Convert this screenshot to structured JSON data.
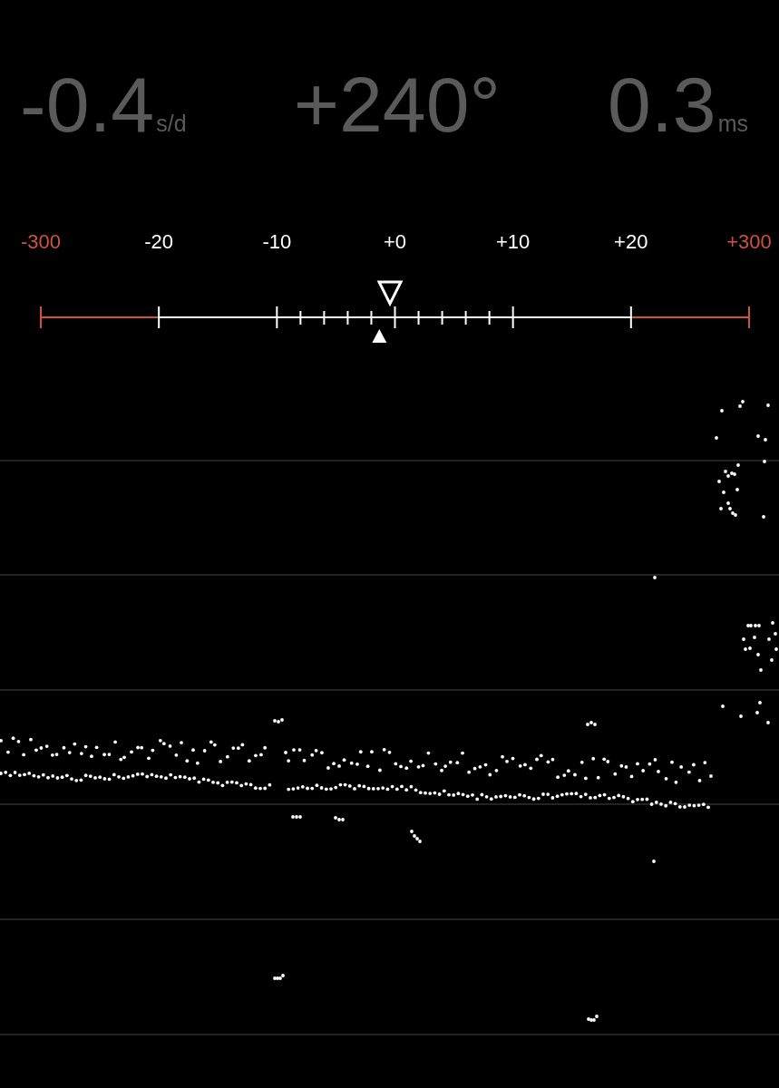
{
  "readings": [
    {
      "value": "-0.4",
      "unit": "s/d"
    },
    {
      "value": "+240°"
    },
    {
      "value": "0.3",
      "unit": "ms"
    }
  ],
  "scale": {
    "ticks": [
      {
        "label": "-300",
        "color": "#cf5240"
      },
      {
        "label": "-20",
        "color": "#ffffff"
      },
      {
        "label": "-10",
        "color": "#ffffff"
      },
      {
        "label": "+0",
        "color": "#ffffff"
      },
      {
        "label": "+10",
        "color": "#ffffff"
      },
      {
        "label": "+20",
        "color": "#ffffff"
      },
      {
        "label": "+300",
        "color": "#cf5240"
      }
    ],
    "segments": [
      {
        "color": "#cf5240",
        "subdivided": false
      },
      {
        "color": "#ffffff",
        "subdivided": false
      },
      {
        "color": "#ffffff",
        "subdivided": true
      },
      {
        "color": "#ffffff",
        "subdivided": true
      },
      {
        "color": "#ffffff",
        "subdivided": false
      },
      {
        "color": "#cf5240",
        "subdivided": false
      }
    ],
    "markers": [
      {
        "kind": "outline",
        "level": 0.493
      },
      {
        "kind": "filled",
        "level": 0.478
      }
    ]
  }
}
